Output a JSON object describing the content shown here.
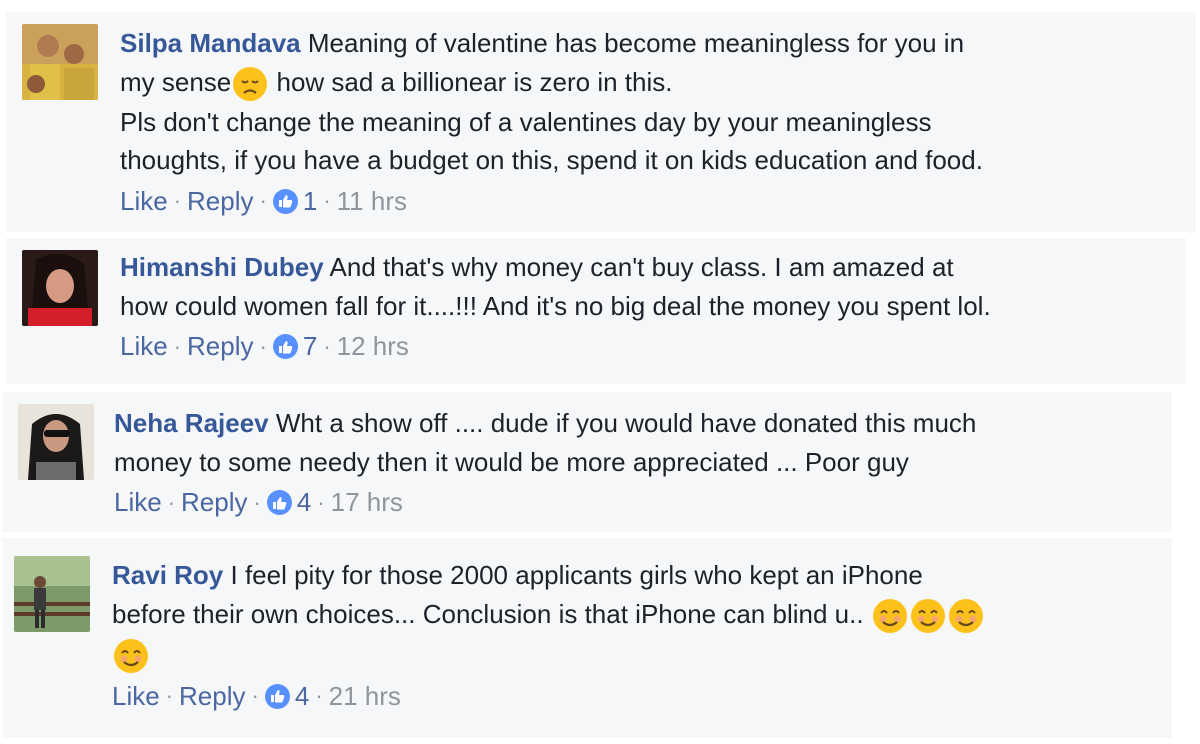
{
  "comments": [
    {
      "author": "Silpa Mandava",
      "text_line1": "Meaning of valentine has become meaningless for you in",
      "text_line2a": "my sense",
      "text_line2b": " how sad a billionear is zero in this.",
      "text_line3": "Pls don't change the meaning of a valentines day by your meaningless",
      "text_line4": "thoughts, if you have a budget on this, spend it on kids education and food.",
      "like_label": "Like",
      "reply_label": "Reply",
      "reactions": "1",
      "time": "11 hrs"
    },
    {
      "author": "Himanshi Dubey",
      "text_line1": "And that's why money can't buy class. I am amazed at",
      "text_line2": "how could women fall for it....!!! And it's no big deal the money you spent lol.",
      "like_label": "Like",
      "reply_label": "Reply",
      "reactions": "7",
      "time": "12 hrs"
    },
    {
      "author": "Neha Rajeev",
      "text_line1": "Wht a show off .... dude if you would have donated this much",
      "text_line2": "money to some needy then it would be more appreciated ... Poor guy",
      "like_label": "Like",
      "reply_label": "Reply",
      "reactions": "4",
      "time": "17 hrs"
    },
    {
      "author": "Ravi Roy",
      "text_line1": "I feel pity for those 2000 applicants girls who kept an iPhone",
      "text_line2": "before their own choices... Conclusion is that iPhone can blind u..",
      "like_label": "Like",
      "reply_label": "Reply",
      "reactions": "4",
      "time": "21 hrs"
    }
  ],
  "icons": {
    "like": "thumbs-up-icon",
    "sad_emoji": "disappointed-face-icon",
    "smile_emoji": "smiling-face-icon"
  },
  "colors": {
    "author": "#365899",
    "text": "#1d2129",
    "meta": "#90949c",
    "like_badge": "#5890ff",
    "comment_bg": "#f6f7f9"
  }
}
